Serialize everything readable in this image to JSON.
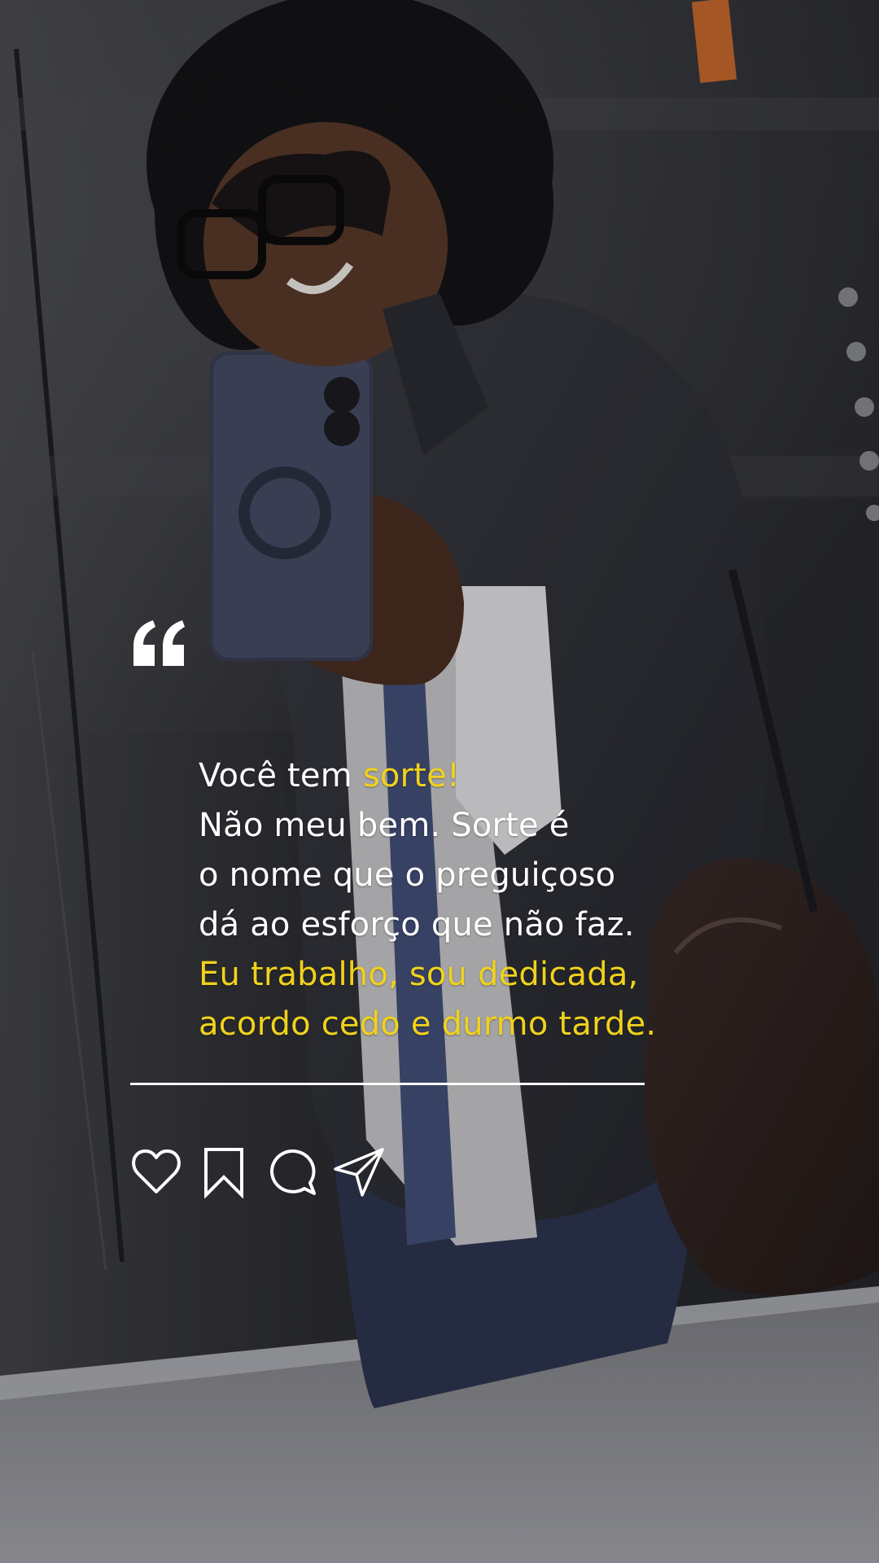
{
  "post": {
    "quote": {
      "line1_a": "Você tem ",
      "line1_b": "sorte!",
      "line2": "Não meu bem. Sorte é",
      "line3": "o nome que o preguiçoso",
      "line4": "dá ao esforço que não faz.",
      "line5": "Eu trabalho, sou dedicada,",
      "line6": "acordo cedo e durmo tarde."
    },
    "actions": [
      {
        "name": "like",
        "icon": "heart-icon"
      },
      {
        "name": "save",
        "icon": "bookmark-icon"
      },
      {
        "name": "comment",
        "icon": "comment-icon"
      },
      {
        "name": "share",
        "icon": "send-icon"
      }
    ]
  },
  "colors": {
    "highlight": "#f0d21c",
    "text": "#ffffff"
  }
}
